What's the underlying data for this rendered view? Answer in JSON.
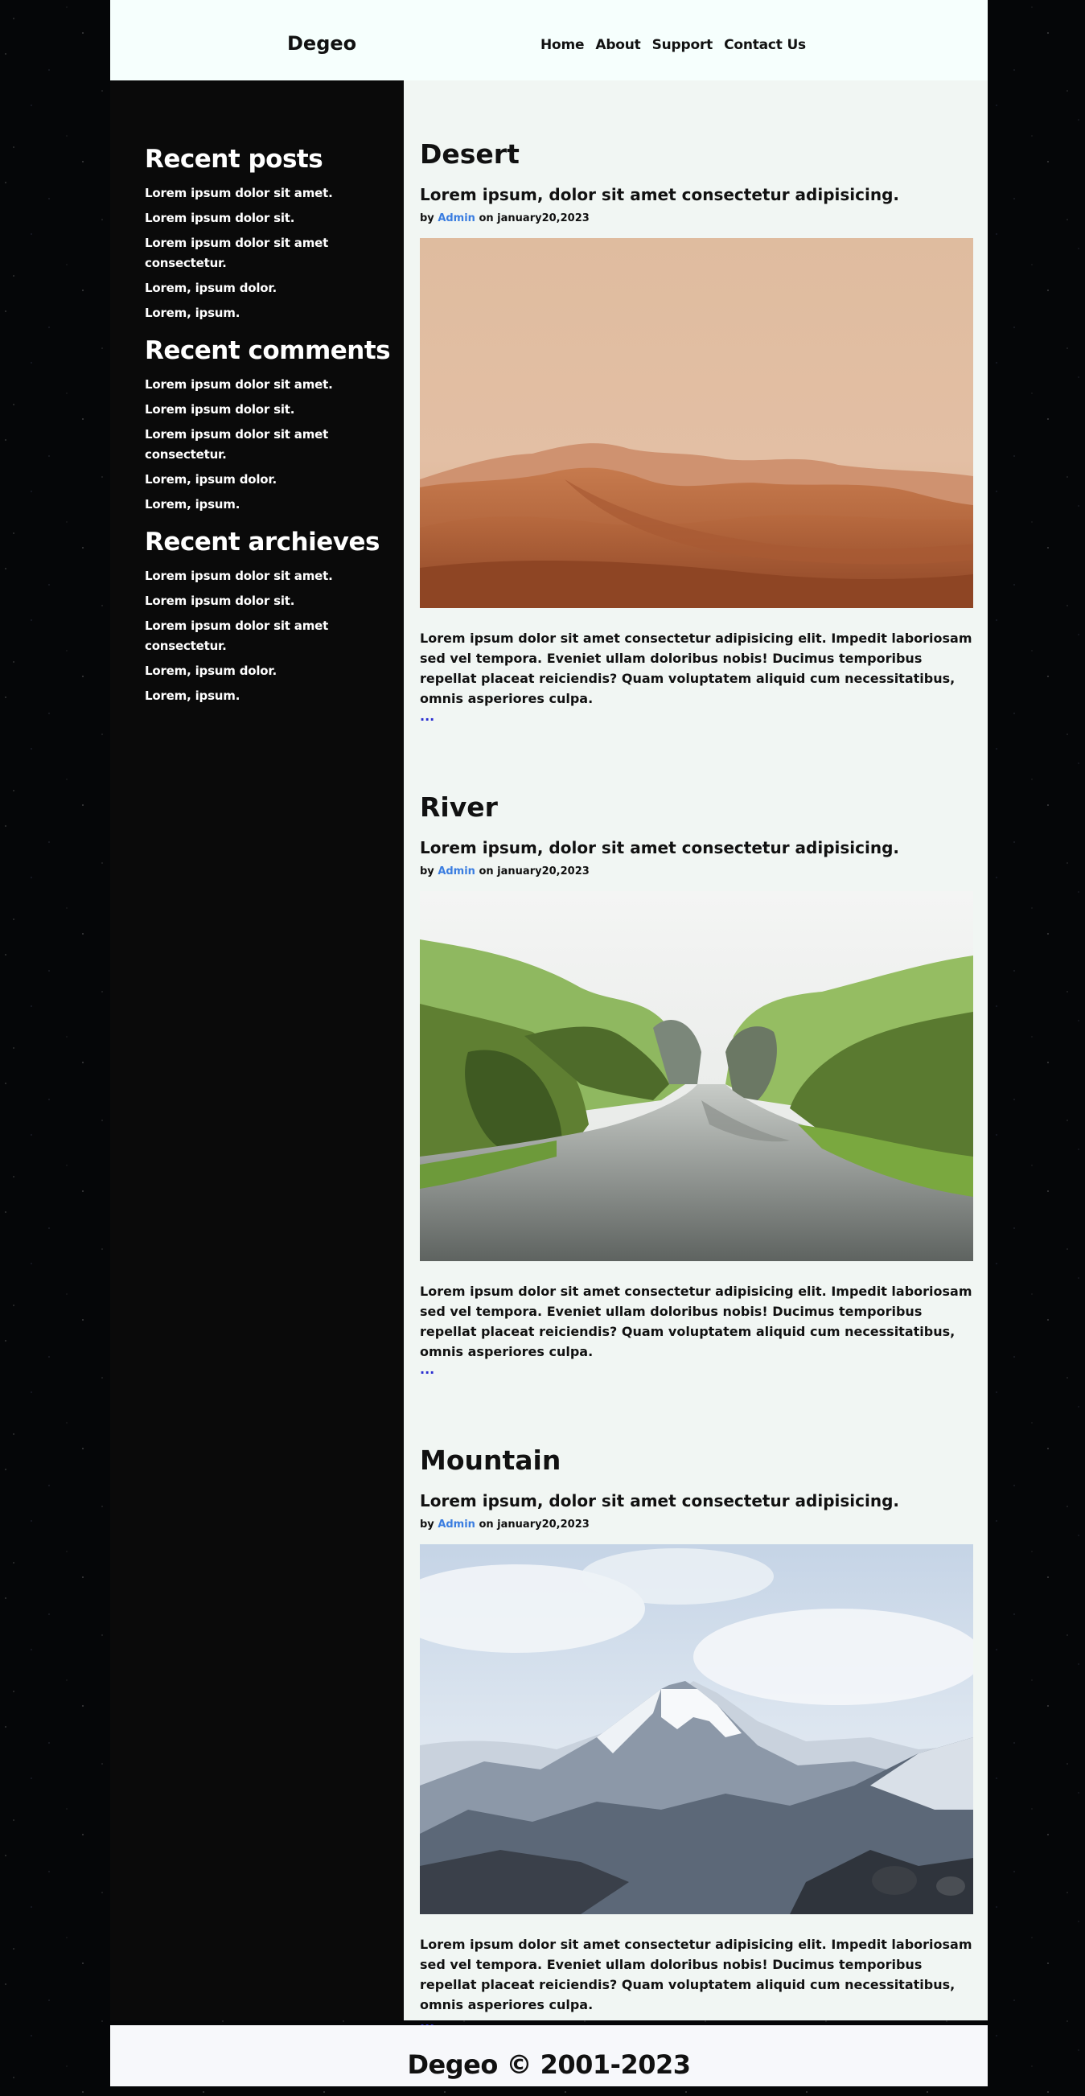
{
  "header": {
    "logo": "Degeo",
    "nav": [
      "Home",
      "About",
      "Support",
      "Contact Us"
    ]
  },
  "sidebar": {
    "sections": [
      {
        "heading": "Recent posts",
        "items": [
          "Lorem ipsum dolor sit amet.",
          "Lorem ipsum dolor sit.",
          "Lorem ipsum dolor sit amet consectetur.",
          "Lorem, ipsum dolor.",
          "Lorem, ipsum."
        ]
      },
      {
        "heading": "Recent comments",
        "items": [
          "Lorem ipsum dolor sit amet.",
          "Lorem ipsum dolor sit.",
          "Lorem ipsum dolor sit amet consectetur.",
          "Lorem, ipsum dolor.",
          "Lorem, ipsum."
        ]
      },
      {
        "heading": "Recent archieves",
        "items": [
          "Lorem ipsum dolor sit amet.",
          "Lorem ipsum dolor sit.",
          "Lorem ipsum dolor sit amet consectetur.",
          "Lorem, ipsum dolor.",
          "Lorem, ipsum."
        ]
      }
    ]
  },
  "posts": [
    {
      "title": "Desert",
      "subtitle": "Lorem ipsum, dolor sit amet consectetur adipisicing.",
      "meta_by": "by",
      "meta_author": "Admin",
      "meta_date": "on january20,2023",
      "image": "desert-dunes-photo",
      "text": "Lorem ipsum dolor sit amet consectetur adipisicing elit. Impedit laboriosam sed vel tempora. Eveniet ullam doloribus nobis! Ducimus temporibus repellat placeat reiciendis? Quam voluptatem aliquid cum necessitatibus, omnis asperiores culpa.",
      "more": "..."
    },
    {
      "title": "River",
      "subtitle": "Lorem ipsum, dolor sit amet consectetur adipisicing.",
      "meta_by": "by",
      "meta_author": "Admin",
      "meta_date": "on january20,2023",
      "image": "river-canyon-photo",
      "text": "Lorem ipsum dolor sit amet consectetur adipisicing elit. Impedit laboriosam sed vel tempora. Eveniet ullam doloribus nobis! Ducimus temporibus repellat placeat reiciendis? Quam voluptatem aliquid cum necessitatibus, omnis asperiores culpa.",
      "more": "..."
    },
    {
      "title": "Mountain",
      "subtitle": "Lorem ipsum, dolor sit amet consectetur adipisicing.",
      "meta_by": "by",
      "meta_author": "Admin",
      "meta_date": "on january20,2023",
      "image": "snowy-mountain-photo",
      "text": "Lorem ipsum dolor sit amet consectetur adipisicing elit. Impedit laboriosam sed vel tempora. Eveniet ullam doloribus nobis! Ducimus temporibus repellat placeat reiciendis? Quam voluptatem aliquid cum necessitatibus, omnis asperiores culpa.",
      "more": "..."
    }
  ],
  "footer": {
    "text": "Degeo © 2001-2023"
  },
  "colors": {
    "background": "#050608",
    "header": "#f6fffd",
    "sidebar": "#0a0a0a",
    "main": "#f1f6f3",
    "author_link": "#3a7de0",
    "read_more": "#2a2ed0"
  }
}
